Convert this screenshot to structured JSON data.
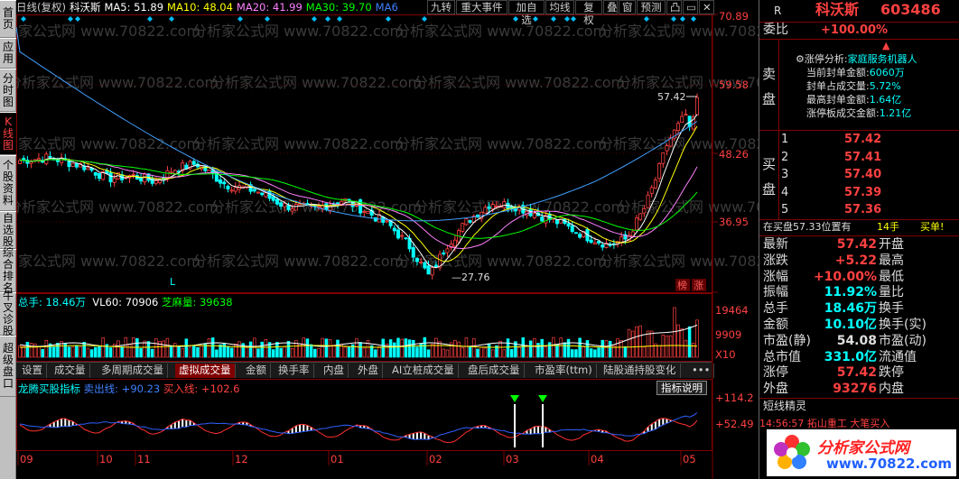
{
  "sidebar": {
    "tabs": [
      {
        "label": "首页",
        "active": false
      },
      {
        "label": "应用",
        "active": false
      },
      {
        "label": "分时图",
        "active": false
      },
      {
        "label": "K线图",
        "active": true
      },
      {
        "label": "个股资料",
        "active": false
      },
      {
        "label": "自选股",
        "active": false
      },
      {
        "label": "综合排名",
        "active": false
      },
      {
        "label": "牛叉诊股",
        "active": false
      },
      {
        "label": "超级盘口",
        "active": false
      }
    ]
  },
  "topbar": {
    "mode": "日线(复权)",
    "stock_name": "科沃斯",
    "ma5": "MA5: 51.89",
    "ma10": "MA10: 48.04",
    "ma20": "MA20: 41.99",
    "ma30": "MA30: 39.70",
    "ma60": "MA6",
    "buttons": [
      "九转",
      "重大事件",
      "加自选",
      "均线",
      "复权",
      "叠",
      "窗",
      "预测",
      "凸",
      "▭",
      "✕"
    ]
  },
  "price_axis": [
    "70.89",
    "59.58",
    "48.26",
    "36.95"
  ],
  "price_labels": {
    "high": "57.42",
    "low": "27.76",
    "L_marker": "L",
    "tags": [
      "榜",
      "涨"
    ]
  },
  "volume": {
    "total": "总手: 18.46万",
    "vl60": "VL60: 70906",
    "zhima": "芝麻量: 39638",
    "axis": [
      "19464",
      "9909",
      "X10"
    ]
  },
  "tabs": [
    "设置",
    "成交量",
    "多周期成交量",
    "虚拟成交量",
    "金额",
    "换手率",
    "内盘",
    "外盘",
    "AI立桩成交量",
    "盘后成交量",
    "市盈率(ttm)",
    "陆股通持股变化",
    "•••"
  ],
  "active_tab": "虚拟成交量",
  "indicator": {
    "name": "龙腾买股指标",
    "sell": "卖出线: +90.23",
    "buy": "买入线: +102.6",
    "explain": "指标说明",
    "axis": [
      "+114.2",
      "+52.49"
    ]
  },
  "dates": [
    "09",
    "10",
    "11",
    "12",
    "01",
    "02",
    "03",
    "04",
    "05"
  ],
  "watermark": "分析家公式网 www.70822.com",
  "right_panel": {
    "r": "R",
    "name": "科沃斯",
    "code": "603486",
    "weibi_label": "委比",
    "weibi_val": "+100.00%",
    "sell_label": "卖盘",
    "buy_label": "买盘",
    "limit_title": "涨停分析:",
    "limit_reason": "家庭服务机器人",
    "limit_rows": [
      {
        "label": "当前封单金额:",
        "val": "6060万"
      },
      {
        "label": "封单占成交量:",
        "val": "5.72%"
      },
      {
        "label": "最高封单金额:",
        "val": "1.64亿"
      },
      {
        "label": "涨停板成交金额:",
        "val": "1.21亿"
      }
    ],
    "bids": [
      {
        "n": "1",
        "price": "57.42",
        "vol": ""
      },
      {
        "n": "2",
        "price": "57.41",
        "vol": ""
      },
      {
        "n": "3",
        "price": "57.40",
        "vol": ""
      },
      {
        "n": "4",
        "price": "57.39",
        "vol": ""
      },
      {
        "n": "5",
        "price": "57.36",
        "vol": ""
      }
    ],
    "bid_note": "在买盘57.33位置有",
    "bid_note_vol": "14手",
    "bid_note_action": "买单!",
    "stats": [
      {
        "l1": "最新",
        "v1": "57.42",
        "l2": "开盘",
        "v2": ""
      },
      {
        "l1": "涨跌",
        "v1": "+5.22",
        "l2": "最高",
        "v2": ""
      },
      {
        "l1": "涨幅",
        "v1": "+10.00%",
        "l2": "最低",
        "v2": ""
      },
      {
        "l1": "振幅",
        "v1": "11.92%",
        "l2": "量比",
        "v2": ""
      },
      {
        "l1": "总手",
        "v1": "18.46万",
        "l2": "换手",
        "v2": ""
      },
      {
        "l1": "金额",
        "v1": "10.10亿",
        "l2": "换手(实)",
        "v2": ""
      },
      {
        "l1": "市盈(静)",
        "v1": "54.08",
        "l2": "市盈(动)",
        "v2": ""
      },
      {
        "l1": "总市值",
        "v1": "331.0亿",
        "l2": "流通值",
        "v2": ""
      },
      {
        "l1": "涨停",
        "v1": "57.42",
        "l2": "跌停",
        "v2": ""
      },
      {
        "l1": "外盘",
        "v1": "93276",
        "l2": "内盘",
        "v2": ""
      }
    ],
    "sprite_title": "短线精灵",
    "sprite_row": "14:56:57   拓山重工   大笔买入",
    "logo_text": "分析家公式网",
    "logo_url": "www.70822.com"
  },
  "colors": {
    "red": "#ff4040",
    "green": "#00ff00",
    "cyan": "#00ffff",
    "yellow": "#ffff00",
    "magenta": "#ff80ff"
  }
}
